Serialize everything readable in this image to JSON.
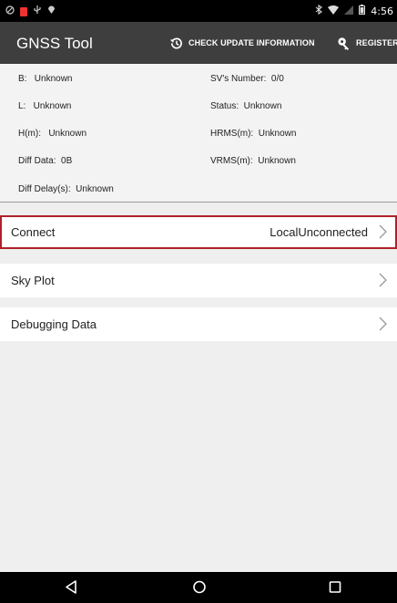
{
  "status_bar": {
    "left_icons": [
      "alarm-icon",
      "notification-icon",
      "usb-icon",
      "location-pin-icon"
    ],
    "right_icons": [
      "bluetooth-icon",
      "wifi-icon",
      "signal-off-icon",
      "battery-icon"
    ],
    "time": "4:56"
  },
  "app_bar": {
    "title": "GNSS Tool",
    "check_update_label": "CHECK UPDATE INFORMATION",
    "register_label": "REGISTER"
  },
  "info": {
    "b": "B:   Unknown",
    "l": "L:   Unknown",
    "h": "H(m):   Unknown",
    "diff_data": "Diff Data:  0B",
    "diff_delay": "Diff Delay(s):  Unknown",
    "sv_number": "SV's Number:  0/0",
    "status": "Status:  Unknown",
    "hrms": "HRMS(m):  Unknown",
    "vrms": "VRMS(m):  Unknown"
  },
  "menu": [
    {
      "label": "Connect",
      "value": "LocalUnconnected"
    },
    {
      "label": "Sky Plot",
      "value": ""
    },
    {
      "label": "Debugging Data",
      "value": ""
    }
  ],
  "colors": {
    "app_bar": "#3e3e3e",
    "selection_border": "#b0202a",
    "background": "#efefef"
  }
}
